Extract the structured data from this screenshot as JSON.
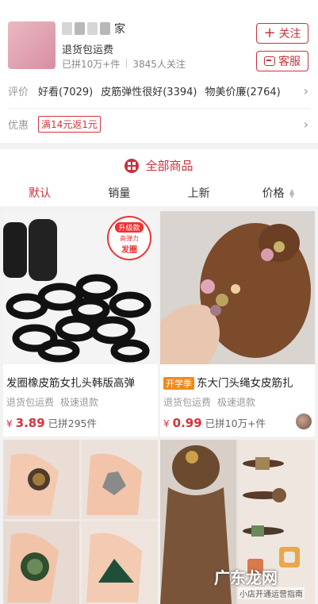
{
  "shop": {
    "name_tail": "家",
    "subtitle": "退货包运费",
    "group_count": "已拼10万+件",
    "followers": "3845人关注",
    "follow_label": "关注",
    "service_label": "客服"
  },
  "reviews": {
    "label": "评价",
    "tags": [
      "好看(7029)",
      "皮筋弹性很好(3394)",
      "物美价廉(2764)"
    ]
  },
  "promo": {
    "label": "优惠",
    "badge": "满14元返1元"
  },
  "goods": {
    "header": "全部商品",
    "sort_tabs": [
      "默认",
      "销量",
      "上新",
      "价格"
    ],
    "active_tab": "默认"
  },
  "products": [
    {
      "title": "发圈橡皮筋女扎头韩版高弹",
      "tags": [
        "退货包运费",
        "极速退款"
      ],
      "currency": "¥",
      "price": "3.89",
      "sold": "已拼295件",
      "badge_top": "升级款",
      "badge_mid": "高弹力",
      "badge_bottom": "发圈"
    },
    {
      "badge": "开学季",
      "title": "东大门头绳女皮筋扎",
      "tags": [
        "退货包运费",
        "极速退款"
      ],
      "currency": "¥",
      "price": "0.99",
      "sold": "已拼10万+件"
    }
  ],
  "watermark": {
    "main": "广东龙网",
    "sub": "小店开通运营指南"
  },
  "colors": {
    "accent": "#c8323a",
    "price": "#d6333c",
    "badge_orange": "#f08a1c"
  }
}
